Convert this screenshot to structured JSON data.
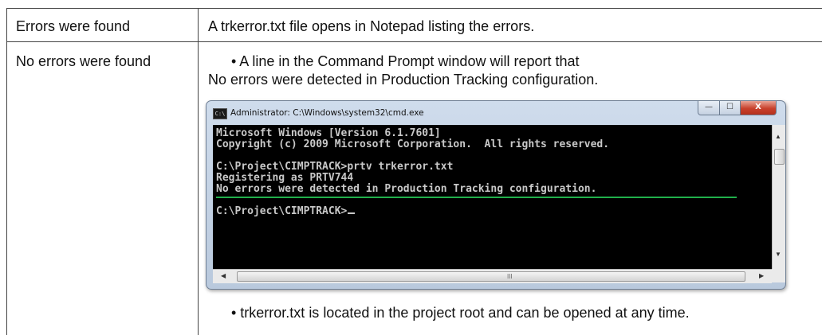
{
  "table": {
    "rows": [
      {
        "condition": "Errors were found",
        "result_text": "A trkerror.txt file opens in Notepad listing the errors."
      },
      {
        "condition": "No errors were found",
        "bullet_1_line_1": "• A line in the Command Prompt window will report that",
        "bullet_1_line_2": "No errors were detected in Production Tracking configuration.",
        "bullet_2": "• trkerror.txt is located in the project root and can be opened at any time."
      }
    ]
  },
  "cmd_window": {
    "icon_text": "C:\\",
    "title": "Administrator: C:\\Windows\\system32\\cmd.exe",
    "buttons": {
      "minimize": "—",
      "maximize": "☐",
      "close": "X"
    },
    "console_lines": [
      "Microsoft Windows [Version 6.1.7601]",
      "Copyright (c) 2009 Microsoft Corporation.  All rights reserved.",
      "",
      "C:\\Project\\CIMPTRACK>prtv trkerror.txt",
      "Registering as PRTV744",
      "No errors were detected in Production Tracking configuration.",
      "",
      "C:\\Project\\CIMPTRACK>"
    ],
    "underline_color": "#21b04b",
    "scrollbar_grip": "III"
  }
}
